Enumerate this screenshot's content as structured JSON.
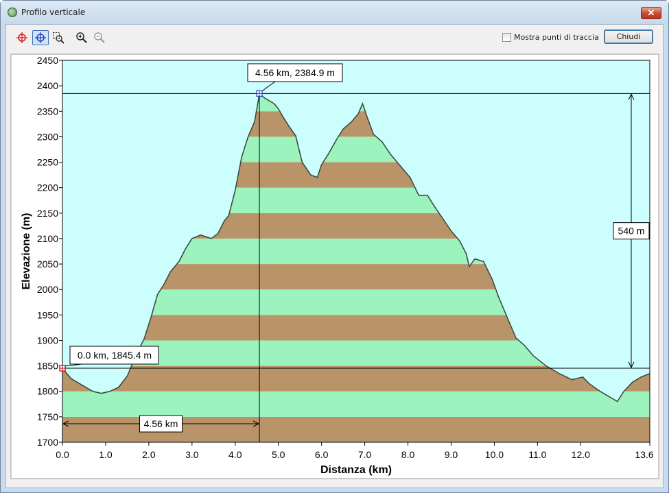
{
  "window": {
    "title": "Profilo verticale",
    "close_glyph": "✕"
  },
  "toolbar": {
    "tools": [
      {
        "name": "crosshair-red-icon"
      },
      {
        "name": "crosshair-blue-icon"
      },
      {
        "name": "zoom-area-icon"
      },
      {
        "name": "zoom-in-icon"
      },
      {
        "name": "zoom-out-icon"
      }
    ],
    "show_points_label": "Mostra punti di traccia",
    "show_points_checked": false,
    "close_label": "Chiudi"
  },
  "chart_data": {
    "type": "area",
    "xlabel": "Distanza  (km)",
    "ylabel": "Elevazione  (m)",
    "xlim": [
      0,
      13.6
    ],
    "ylim": [
      1700,
      2450
    ],
    "x_ticks": [
      {
        "v": 0.0,
        "label": "0.0"
      },
      {
        "v": 1.0,
        "label": "1.0"
      },
      {
        "v": 2.0,
        "label": "2.0"
      },
      {
        "v": 3.0,
        "label": "3.0"
      },
      {
        "v": 4.0,
        "label": "4.0"
      },
      {
        "v": 5.0,
        "label": "5.0"
      },
      {
        "v": 6.0,
        "label": "6.0"
      },
      {
        "v": 7.0,
        "label": "7.0"
      },
      {
        "v": 8.0,
        "label": "8.0"
      },
      {
        "v": 9.0,
        "label": "9.0"
      },
      {
        "v": 10.0,
        "label": "10.0"
      },
      {
        "v": 11.0,
        "label": "11.0"
      },
      {
        "v": 12.0,
        "label": "12.0"
      },
      {
        "v": 13.6,
        "label": "13.6"
      }
    ],
    "y_ticks": [
      1700,
      1750,
      1800,
      1850,
      1900,
      1950,
      2000,
      2050,
      2100,
      2150,
      2200,
      2250,
      2300,
      2350,
      2400,
      2450
    ],
    "band_step": 50,
    "colors": {
      "sky": "#ccfefe",
      "band_light": "#9cf3be",
      "band_dark": "#b99469",
      "profile_line": "#3e4b40"
    },
    "profile": {
      "x": [
        0.0,
        0.2,
        0.5,
        0.7,
        0.9,
        1.1,
        1.3,
        1.5,
        1.7,
        1.9,
        2.05,
        2.2,
        2.35,
        2.5,
        2.7,
        2.85,
        3.0,
        3.2,
        3.45,
        3.6,
        3.75,
        3.85,
        4.0,
        4.15,
        4.3,
        4.45,
        4.56,
        4.7,
        4.9,
        5.0,
        5.1,
        5.25,
        5.4,
        5.55,
        5.75,
        5.9,
        6.0,
        6.15,
        6.35,
        6.5,
        6.7,
        6.85,
        6.95,
        7.05,
        7.2,
        7.4,
        7.6,
        7.8,
        8.05,
        8.25,
        8.45,
        8.6,
        8.8,
        9.0,
        9.2,
        9.35,
        9.42,
        9.55,
        9.75,
        9.95,
        10.1,
        10.3,
        10.5,
        10.7,
        10.9,
        11.2,
        11.5,
        11.8,
        12.05,
        12.2,
        12.45,
        12.65,
        12.85,
        13.0,
        13.2,
        13.4,
        13.6
      ],
      "y": [
        1845,
        1825,
        1810,
        1800,
        1796,
        1800,
        1808,
        1830,
        1870,
        1905,
        1945,
        1990,
        2010,
        2035,
        2055,
        2080,
        2100,
        2107,
        2100,
        2110,
        2135,
        2145,
        2195,
        2260,
        2300,
        2330,
        2384,
        2375,
        2365,
        2355,
        2340,
        2320,
        2302,
        2250,
        2225,
        2220,
        2245,
        2265,
        2295,
        2315,
        2330,
        2345,
        2365,
        2340,
        2305,
        2290,
        2265,
        2245,
        2220,
        2185,
        2185,
        2165,
        2140,
        2115,
        2095,
        2070,
        2045,
        2060,
        2055,
        2020,
        1985,
        1945,
        1905,
        1890,
        1870,
        1850,
        1835,
        1823,
        1828,
        1815,
        1800,
        1790,
        1780,
        1800,
        1818,
        1828,
        1835
      ]
    },
    "annotations": {
      "start_label": "0.0 km, 1845.4 m",
      "start_point": {
        "x": 0.0,
        "y": 1845.4
      },
      "peak_label": "4.56 km, 2384.9 m",
      "peak_point": {
        "x": 4.56,
        "y": 2384.9
      },
      "elevation_gain_label": "540 m",
      "distance_label": "4.56 km"
    }
  }
}
